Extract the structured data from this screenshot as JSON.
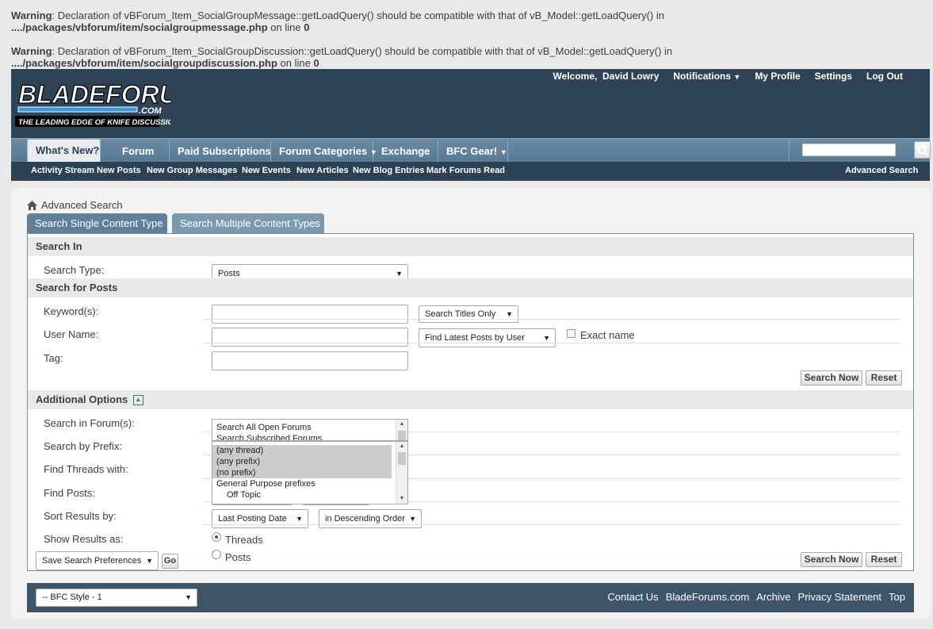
{
  "warnings": [
    {
      "label": "Warning",
      "message": ": Declaration of vBForum_Item_SocialGroupMessage::getLoadQuery() should be compatible with that of vB_Model::getLoadQuery() in",
      "path": "..../packages/vbforum/item/socialgroupmessage.php",
      "line_text": " on line ",
      "line": "0"
    },
    {
      "label": "Warning",
      "message": ": Declaration of vBForum_Item_SocialGroupDiscussion::getLoadQuery() should be compatible with that of vB_Model::getLoadQuery() in",
      "path": "..../packages/vbforum/item/socialgroupdiscussion.php",
      "line_text": " on line ",
      "line": "0"
    }
  ],
  "logo": {
    "main": "BLADEFORUMS",
    "com": ".COM",
    "tagline": "THE LEADING EDGE OF KNIFE DISCUSSION"
  },
  "toplinks": {
    "welcome": "Welcome,",
    "user": "David Lowry",
    "notifications": "Notifications",
    "profile": "My Profile",
    "settings": "Settings",
    "logout": "Log Out"
  },
  "nav": {
    "tabs": [
      "What's New?",
      "Forum",
      "Paid Subscriptions",
      "Forum Categories",
      "Exchange",
      "BFC Gear!"
    ],
    "subnav": [
      "Activity Stream",
      "New Posts",
      "New Group Messages",
      "New Events",
      "New Articles",
      "New Blog Entries",
      "Mark Forums Read"
    ],
    "advanced_search": "Advanced Search"
  },
  "breadcrumb": "Advanced Search",
  "tabs": {
    "single": "Search Single Content Type",
    "multiple": "Search Multiple Content Types"
  },
  "form": {
    "search_in": "Search In",
    "search_type_label": "Search Type:",
    "search_type_value": "Posts",
    "search_for_posts": "Search for Posts",
    "keywords_label": "Keyword(s):",
    "titles_only": "Search Titles Only",
    "username_label": "User Name:",
    "find_latest": "Find Latest Posts by User",
    "exact_name": "Exact name",
    "tag_label": "Tag:",
    "search_now": "Search Now",
    "reset": "Reset",
    "additional_options": "Additional Options",
    "forums_label": "Search in Forum(s):",
    "forum_options": [
      "Search All Open Forums",
      "Search Subscribed Forums"
    ],
    "prefix_label": "Search by Prefix:",
    "prefix_options": [
      "(any thread)",
      "(any prefix)",
      "(no prefix)",
      "General Purpose prefixes",
      "Off Topic"
    ],
    "threads_label": "Find Threads with:",
    "posts_label": "Find Posts:",
    "sort_label": "Sort Results by:",
    "sort_value": "Last Posting Date",
    "order_value": "in Descending Order",
    "show_label": "Show Results as:",
    "show_threads": "Threads",
    "show_posts": "Posts",
    "save_prefs": "Save Search Preferences",
    "go": "Go"
  },
  "footer": {
    "style": "-- BFC Style - 1",
    "links": [
      "Contact Us",
      "BladeForums.com",
      "Archive",
      "Privacy Statement",
      "Top"
    ]
  }
}
